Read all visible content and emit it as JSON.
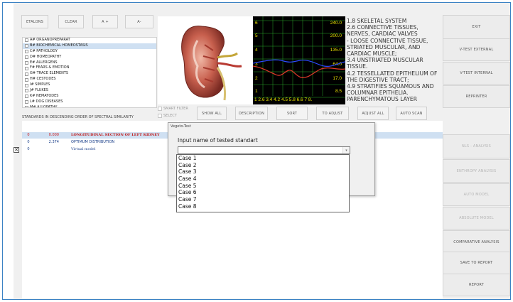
{
  "toolbar": {
    "etalons": "ETALONS",
    "clear": "CLEAR",
    "zoom_in": "A +",
    "zoom_out": "A-"
  },
  "categories": [
    "A# ORGANOPREPARAT",
    "B# BIOCHEMICAL HOMEOSTASIS",
    "C# PATHOLOGY",
    "D# HOMEOPATHY",
    "E# ALLERGENS",
    "F# FEARS & EMOTION",
    "G# TRACE ELEMENTS",
    "H# CESTODES",
    "I# SIMPLES",
    "J# FLUKES",
    "K# NEMATODES",
    "L# DOG DISEASES",
    "M# ALLOPATHY"
  ],
  "selected_category": 1,
  "scope": {
    "y_labels": [
      "240.0",
      "200.0",
      "135.0",
      "64.0",
      "17.0",
      "8.5"
    ],
    "left_labels": [
      "6",
      "5",
      "4",
      "3",
      "2",
      "1"
    ],
    "x_axis": "1  2.6  3.4  4.2  4.5  5.8  6.6  7  8."
  },
  "description": "1.8 SKELETAL SYSTEM\n2.6 CONNECTIVE TISSUES, NERVES, CARDIAC VALVES\n- LOOSE CONNECTIVE TISSUE, STRIATED MUSCULAR, AND CARDIAC MUSCLE;\n3.4 UNSTRIATED MUSCULAR TISSUE.\n4.2 TESSELLATED EPITHELIUM OF THE DIGESTIVE TRACT;\n4.9 STRATIFIES SQUAMOUS AND COLUMNAR EPITHELIA.\nPARENCHYMATOUS LAYER",
  "checks": {
    "smart_filter": "SMART FILTER",
    "select": "SELECT"
  },
  "actions": {
    "show_all": "SHOW ALL",
    "description": "DESCRIPTION",
    "sort": "SORT",
    "to_adjust": "To ADJUST",
    "adjust_all": "ADJUST ALL",
    "auto_scan": "AUTO SCAN"
  },
  "side": {
    "exit": "EXIT",
    "vtest_external": "V-TEST EXTERNAL",
    "vtest_internal": "V-TEST INTERNAL",
    "reprinter": "REPRINTER",
    "nls_analysis": "NLS - ANALYSIS",
    "enthropy_analysis": "ENTHROPY ANALYSIS",
    "auto_model": "AUTO MODEL",
    "absolute_model": "ABSOLUTE MODEL",
    "comparative_analysis": "COMPARATIVE ANALYSIS",
    "save_to_report": "SAVE TO REPORT",
    "report": "REPORT"
  },
  "grid": {
    "caption": "STANDARDS IN DESCENDING ORDER OF SPECTRAL SIMILARITY",
    "rows": [
      {
        "num": "0",
        "value": "0.000",
        "name": "LONGITUDINAL SECTION OF LEFT KIDNEY"
      },
      {
        "num": "0",
        "value": "2.374",
        "name": "OPTIMUM DISTRIBUTION"
      },
      {
        "num": "0",
        "value": "",
        "name": "Virtual model"
      }
    ]
  },
  "dialog": {
    "title": "Vegeto-Test",
    "label": "Input name of tested standart",
    "input_value": "",
    "options": [
      "Case 1",
      "Case 2",
      "Case 3",
      "Case 4",
      "Case 5",
      "Case 6",
      "Case 7",
      "Case 8"
    ]
  },
  "colors": {
    "accent": "#3b82c4",
    "selection": "#cfe0f2",
    "scope_yellow": "#e8e000",
    "scope_red": "#e03a2a",
    "scope_blue": "#2d4bff",
    "scope_grid": "#2aa52a"
  }
}
